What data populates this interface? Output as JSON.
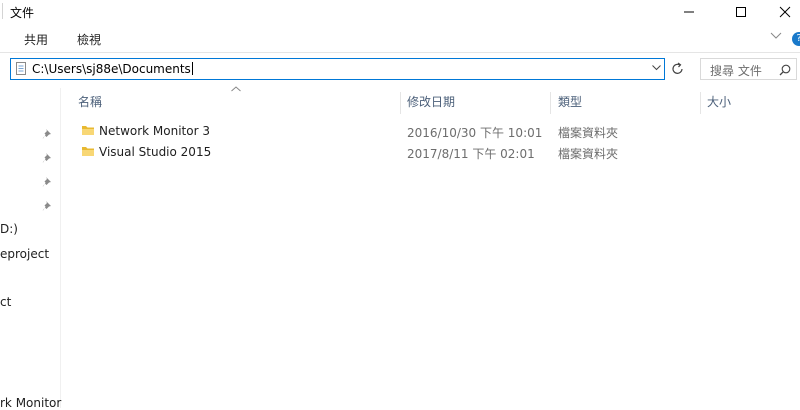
{
  "window": {
    "title": "文件"
  },
  "ribbon": {
    "tabs": [
      "共用",
      "檢視"
    ]
  },
  "address": {
    "path": "C:\\Users\\sj88e\\Documents"
  },
  "search": {
    "placeholder": "搜尋 文件"
  },
  "nav": {
    "items": [
      "D:)",
      "eproject",
      "ct",
      "rk Monitor"
    ]
  },
  "columns": {
    "name": "名稱",
    "modified": "修改日期",
    "type": "類型",
    "size": "大小"
  },
  "files": [
    {
      "name": "Network Monitor 3",
      "modified": "2016/10/30 下午 10:01",
      "type": "檔案資料夾"
    },
    {
      "name": "Visual Studio 2015",
      "modified": "2017/8/11 下午 02:01",
      "type": "檔案資料夾"
    }
  ],
  "colors": {
    "accent": "#0078d7",
    "folder": "#e8b931",
    "header_text": "#4c607a"
  }
}
